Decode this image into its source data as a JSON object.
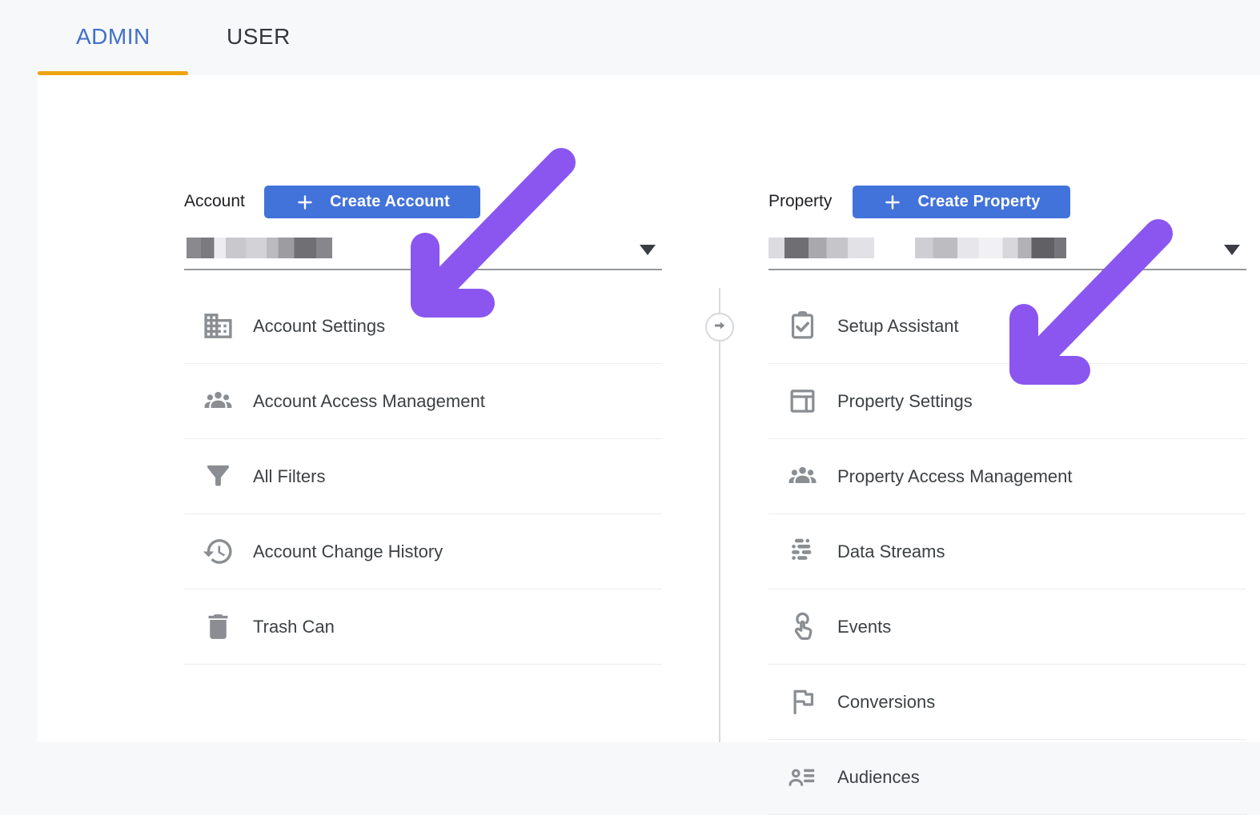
{
  "tabs": {
    "admin": "ADMIN",
    "user": "USER"
  },
  "account_column": {
    "label": "Account",
    "create_button": "Create Account",
    "selector_redacted": true,
    "items": [
      {
        "label": "Account Settings",
        "icon": "building-icon"
      },
      {
        "label": "Account Access Management",
        "icon": "people-group-icon"
      },
      {
        "label": "All Filters",
        "icon": "filter-icon"
      },
      {
        "label": "Account Change History",
        "icon": "history-icon"
      },
      {
        "label": "Trash Can",
        "icon": "trash-icon"
      }
    ]
  },
  "property_column": {
    "label": "Property",
    "create_button": "Create Property",
    "selector_redacted": true,
    "items": [
      {
        "label": "Setup Assistant",
        "icon": "clipboard-check-icon"
      },
      {
        "label": "Property Settings",
        "icon": "layout-icon"
      },
      {
        "label": "Property Access Management",
        "icon": "people-group-icon"
      },
      {
        "label": "Data Streams",
        "icon": "data-streams-icon"
      },
      {
        "label": "Events",
        "icon": "touch-icon"
      },
      {
        "label": "Conversions",
        "icon": "flag-icon"
      },
      {
        "label": "Audiences",
        "icon": "audience-icon"
      }
    ]
  },
  "middle_connector": {
    "icon": "arrow-right-circle-icon"
  },
  "annotations": {
    "left_arrow_target": "Account Access Management",
    "right_arrow_target": "Property Access Management",
    "arrow_color": "#8a56ef"
  },
  "colors": {
    "tab_active": "#4170c8",
    "tab_underline": "#eda50e",
    "button_blue": "#4273da",
    "icon_gray": "#8a8e92",
    "menu_text": "#3c4043",
    "background": "#f7f8fa"
  }
}
